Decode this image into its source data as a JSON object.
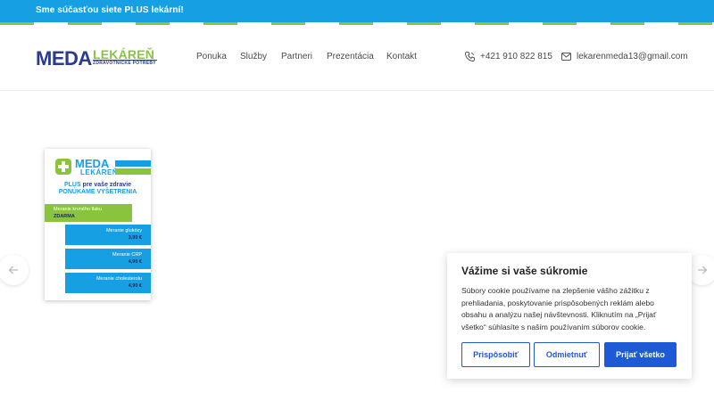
{
  "topbar": {
    "prefix": "Sme súčasťou siete ",
    "highlight": "PLUS lekární!"
  },
  "logo": {
    "meda": "MEDA",
    "lekaren": "LEKÁREŇ",
    "subtitle": "ZDRAVOTNÍCKE POTREBY"
  },
  "nav": {
    "items": [
      {
        "label": "Ponuka"
      },
      {
        "label": "Služby"
      },
      {
        "label": "Partneri"
      },
      {
        "label": "Prezentácia"
      },
      {
        "label": "Kontakt"
      }
    ]
  },
  "contact": {
    "phone": "+421 910 822 815",
    "email": "lekarenmeda13@gmail.com"
  },
  "poster": {
    "brand_top": "MEDA",
    "brand_bottom": "LEKÁREŇ",
    "plus_word": "PLUS",
    "plus_rest": " pre vaše zdravie",
    "headline": "PONÚKAME VYŠETRENIA",
    "free_test": {
      "name": "Meranie krvného tlaku",
      "price": "ZDARMA"
    },
    "tests": [
      {
        "name": "Meranie glukózy",
        "price": "3,90 €"
      },
      {
        "name": "Meranie CRP",
        "price": "4,90 €"
      },
      {
        "name": "Meranie cholesterolu",
        "price": "4,90 €"
      }
    ]
  },
  "cookie": {
    "title": "Vážime si vaše súkromie",
    "body": "Súbory cookie používame na zlepšenie vášho zážitku z prehliadania, poskytovanie prispôsobených reklám alebo obsahu a analýzu našej návštevnosti. Kliknutím na „Prijať všetko“ súhlasíte s naším používaním súborov cookie.",
    "customize_label": "Prispôsobiť",
    "reject_label": "Odmietnuť",
    "accept_label": "Prijať všetko"
  },
  "colors": {
    "topbar": "#16a0e3",
    "brand_green": "#8ac43f",
    "brand_navy": "#2b3b8f",
    "button_blue": "#1f5ad6"
  },
  "icons": {
    "phone": "phone-icon",
    "email": "envelope-icon",
    "prev": "arrow-left-icon",
    "next": "arrow-right-icon"
  }
}
